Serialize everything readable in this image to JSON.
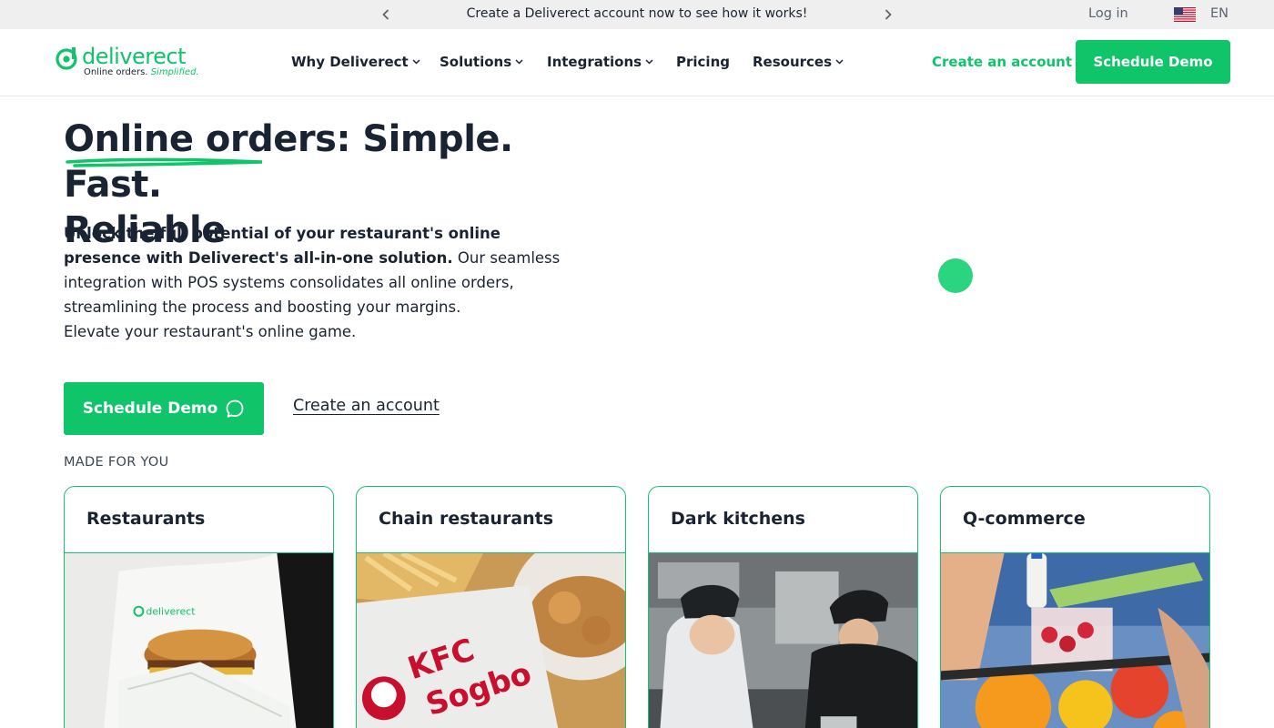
{
  "announcement": {
    "text": "Create a Deliverect account now to see how it works!",
    "prev_icon": "chevron-left-icon",
    "next_icon": "chevron-right-icon",
    "login_label": "Log in",
    "language": "EN",
    "flag": "us-flag-icon"
  },
  "header": {
    "logo_text": "deliverect",
    "logo_tagline": "Online orders.",
    "logo_tagline_accent": "Simplified.",
    "nav": [
      {
        "label": "Why Deliverect",
        "dropdown": true
      },
      {
        "label": "Solutions",
        "dropdown": true
      },
      {
        "label": "Integrations",
        "dropdown": true
      },
      {
        "label": "Pricing",
        "dropdown": false
      },
      {
        "label": "Resources",
        "dropdown": true
      }
    ],
    "create_account_label": "Create an account",
    "schedule_demo_label": "Schedule Demo"
  },
  "hero": {
    "title_line1": "Online orders: Simple. Fast.",
    "title_line2": "Reliable",
    "desc_bold": "Unlock the full potential of your restaurant's online presence with Deliverect's all-in-one solution.",
    "desc_rest": " Our seamless integration with POS systems consolidates all online orders, streamlining the process and boosting your margins.",
    "desc_line2": "Elevate your restaurant's online game.",
    "cta_demo_label": "Schedule Demo",
    "cta_demo_icon": "chat-bubble-icon",
    "cta_create_label": "Create an account"
  },
  "made_for": {
    "heading": "MADE FOR YOU",
    "cards": [
      {
        "title": "Restaurants"
      },
      {
        "title": "Chain restaurants"
      },
      {
        "title": "Dark kitchens"
      },
      {
        "title": "Q-commerce"
      }
    ]
  },
  "colors": {
    "brand_green": "#10c46a",
    "text_dark": "#1a2332",
    "topbar_bg": "#efefef"
  }
}
